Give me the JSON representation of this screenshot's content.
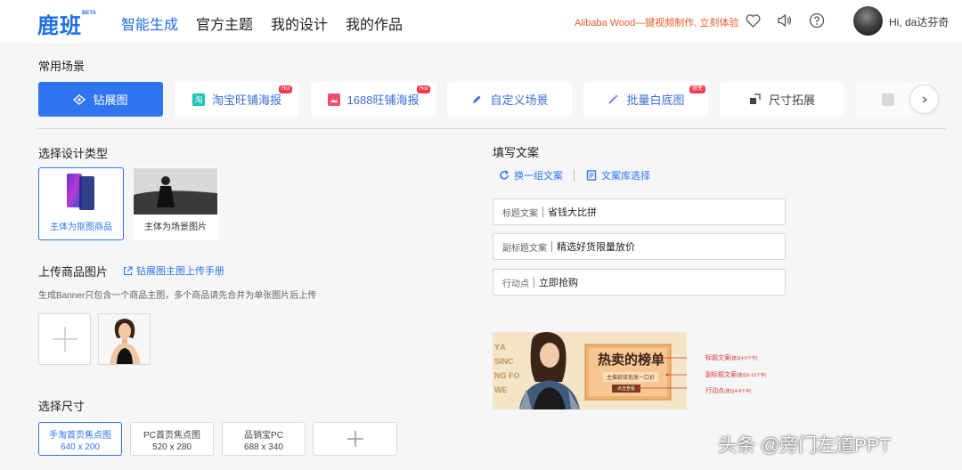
{
  "header": {
    "logo": "鹿班",
    "logo_badge": "BETA",
    "nav": [
      "智能生成",
      "官方主题",
      "我的设计",
      "我的作品"
    ],
    "promo": "Alibaba Wood—键视频制作, 立刻体验",
    "username": "Hi, da达芬奇"
  },
  "scenes": {
    "title": "常用场景",
    "items": [
      {
        "label": "钻展图",
        "icon": "diamond-eye-icon"
      },
      {
        "label": "淘宝旺铺海报",
        "icon": "taobao-icon",
        "badge": "Hot"
      },
      {
        "label": "1688旺铺海报",
        "icon": "image-icon",
        "badge": "Hot"
      },
      {
        "label": "自定义场景",
        "icon": "pen-icon"
      },
      {
        "label": "批量白底图",
        "icon": "magic-wand-icon",
        "badge": "限免"
      },
      {
        "label": "尺寸拓展",
        "icon": "resize-icon"
      }
    ]
  },
  "design_type": {
    "title": "选择设计类型",
    "options": [
      "主体为抠图商品",
      "主体为场景图片"
    ]
  },
  "upload": {
    "title": "上传商品图片",
    "manual_link": "钻展图主图上传手册",
    "hint": "生成Banner只包含一个商品主图，多个商品请先合并为单张图片后上传"
  },
  "size": {
    "title": "选择尺寸",
    "options": [
      {
        "name": "手淘首页焦点图",
        "dim": "640 x 200"
      },
      {
        "name": "PC首页焦点图",
        "dim": "520 x 280"
      },
      {
        "name": "品销宝PC",
        "dim": "688 x 340"
      }
    ]
  },
  "copy": {
    "title": "填写文案",
    "swap_label": "换一组文案",
    "library_label": "文案库选择",
    "fields": [
      {
        "label": "标题文案",
        "value": "省钱大比拼"
      },
      {
        "label": "副标题文案",
        "value": "精选好货限量放价"
      },
      {
        "label": "行动点",
        "value": "立即抢购"
      }
    ]
  },
  "preview": {
    "bg_text": "YA SING FO WE",
    "headline": "热卖的榜单",
    "sub": "主推款接批发一口价",
    "cta": "点击查看",
    "annotations": [
      {
        "label": "标题文案",
        "note": "(建议4-6个字)"
      },
      {
        "label": "副标题文案",
        "note": "(建议6-12个字)"
      },
      {
        "label": "行动点",
        "note": "(建议4-8个字)"
      }
    ]
  },
  "watermark": "头条 @旁门左道PPT",
  "colors": {
    "brand": "#2f74f0",
    "promo": "#f05a28",
    "annotation": "#e03232"
  }
}
